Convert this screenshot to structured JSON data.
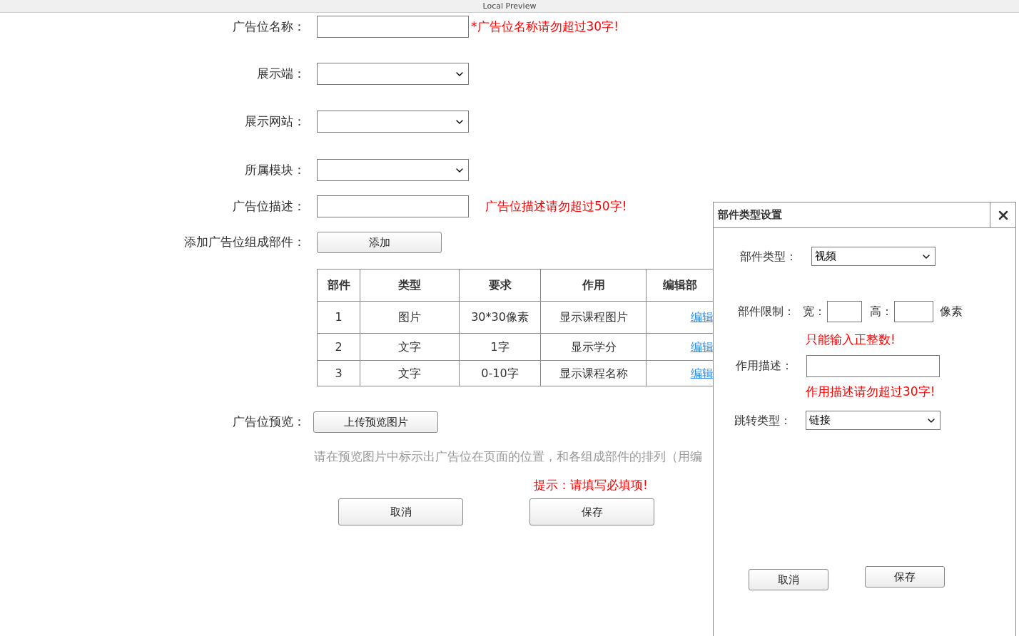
{
  "title_bar": {
    "title": "Local Preview"
  },
  "form": {
    "fields": [
      {
        "kind": "text",
        "label": "广告位名称：",
        "hint": "*广告位名称请勿超过30字!"
      },
      {
        "kind": "select",
        "label": "展示端："
      },
      {
        "kind": "select",
        "label": "展示网站："
      },
      {
        "kind": "select",
        "label": "所属模块："
      },
      {
        "kind": "text",
        "label": "广告位描述：",
        "hint": "广告位描述请勿超过50字!"
      }
    ],
    "components": {
      "label": "添加广告位组成部件：",
      "button": "添加"
    },
    "table": {
      "columns": [
        "部件",
        "类型",
        "要求",
        "作用",
        "编辑部"
      ],
      "rows": [
        {
          "cells": [
            "1",
            "图片",
            "30*30像素",
            "显示课程图片"
          ],
          "link": "编辑"
        },
        {
          "cells": [
            "2",
            "文字",
            "1字",
            "显示学分"
          ],
          "link": "编辑"
        },
        {
          "cells": [
            "3",
            "文字",
            "0-10字",
            "显示课程名称"
          ],
          "link": "编辑"
        }
      ]
    },
    "preview": {
      "label": "广告位预览：",
      "button": "上传预览图片",
      "note": "请在预览图片中标示出广告位在页面的位置，和各组成部件的排列（用编"
    },
    "notice": "提示：请填写必填项!",
    "buttons": [
      "取消",
      "保存"
    ]
  },
  "dialog": {
    "title": "部件类型设置",
    "type": {
      "label": "部件类型：",
      "value": "视频"
    },
    "limit": {
      "label": "部件限制：",
      "width_label": "宽：",
      "height_label": "高：",
      "unit": "像素",
      "error": "只能输入正整数!"
    },
    "description": {
      "label": "作用描述：",
      "error": "作用描述请勿超过30字!"
    },
    "jump": {
      "label": "跳转类型：",
      "value": "链接"
    },
    "buttons": [
      "取消",
      "保存"
    ]
  }
}
